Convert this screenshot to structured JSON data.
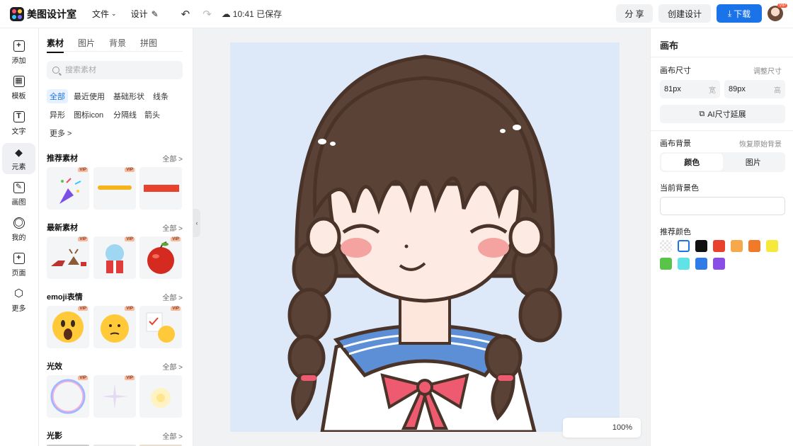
{
  "app": {
    "name": "美图设计室"
  },
  "topbar": {
    "file_menu": "文件",
    "design_menu": "设计",
    "save_status": "10:41 已保存",
    "share_label": "分 享",
    "create_label": "创建设计",
    "download_label": "下载",
    "avatar_badge": "VIP"
  },
  "leftnav": {
    "items": [
      {
        "label": "添加",
        "glyph": "+"
      },
      {
        "label": "模板",
        "glyph": "▦"
      },
      {
        "label": "文字",
        "glyph": "T"
      },
      {
        "label": "元素",
        "glyph": "◆"
      },
      {
        "label": "画图",
        "glyph": "✎"
      },
      {
        "label": "我的",
        "glyph": "◯"
      },
      {
        "label": "页面",
        "glyph": "+"
      },
      {
        "label": "更多",
        "glyph": "⬡"
      }
    ],
    "active_index": 3
  },
  "panel": {
    "tabs": [
      "素材",
      "图片",
      "背景",
      "拼图"
    ],
    "active_tab": 0,
    "search_placeholder": "搜索素材",
    "chips": [
      "全部",
      "最近使用",
      "基础形状",
      "线条",
      "异形",
      "图标icon",
      "分隔线",
      "箭头",
      "更多 >"
    ],
    "sections": [
      {
        "title": "推荐素材",
        "all": "全部 >",
        "vip": [
          "VIP",
          "VIP",
          ""
        ]
      },
      {
        "title": "最新素材",
        "all": "全部 >",
        "vip": [
          "VIP",
          "VIP",
          "VIP"
        ]
      },
      {
        "title": "emoji表情",
        "all": "全部 >",
        "vip": [
          "VIP",
          "VIP",
          "VIP"
        ]
      },
      {
        "title": "光效",
        "all": "全部 >",
        "vip": [
          "VIP",
          "VIP",
          ""
        ]
      },
      {
        "title": "光影",
        "all": "全部 >"
      }
    ]
  },
  "canvas": {
    "zoom": "100%",
    "background": "#dde9f8"
  },
  "right": {
    "title": "画布",
    "size_label": "画布尺寸",
    "resize_link": "调整尺寸",
    "width_value": "81px",
    "width_unit": "宽",
    "height_value": "89px",
    "height_unit": "高",
    "ai_button": "AI尺寸延展",
    "bg_label": "画布背景",
    "restore_link": "恢复原始背景",
    "seg_color": "颜色",
    "seg_image": "图片",
    "current_bg_label": "当前背景色",
    "recommend_label": "推荐颜色",
    "swatches": [
      "transparent",
      "#ffffff",
      "#111111",
      "#e8412c",
      "#f5a94a",
      "#f07a2a",
      "#f5ea3c",
      "#58c44a",
      "#5fe3e6",
      "#2f7be8",
      "#8a4ee6"
    ]
  }
}
